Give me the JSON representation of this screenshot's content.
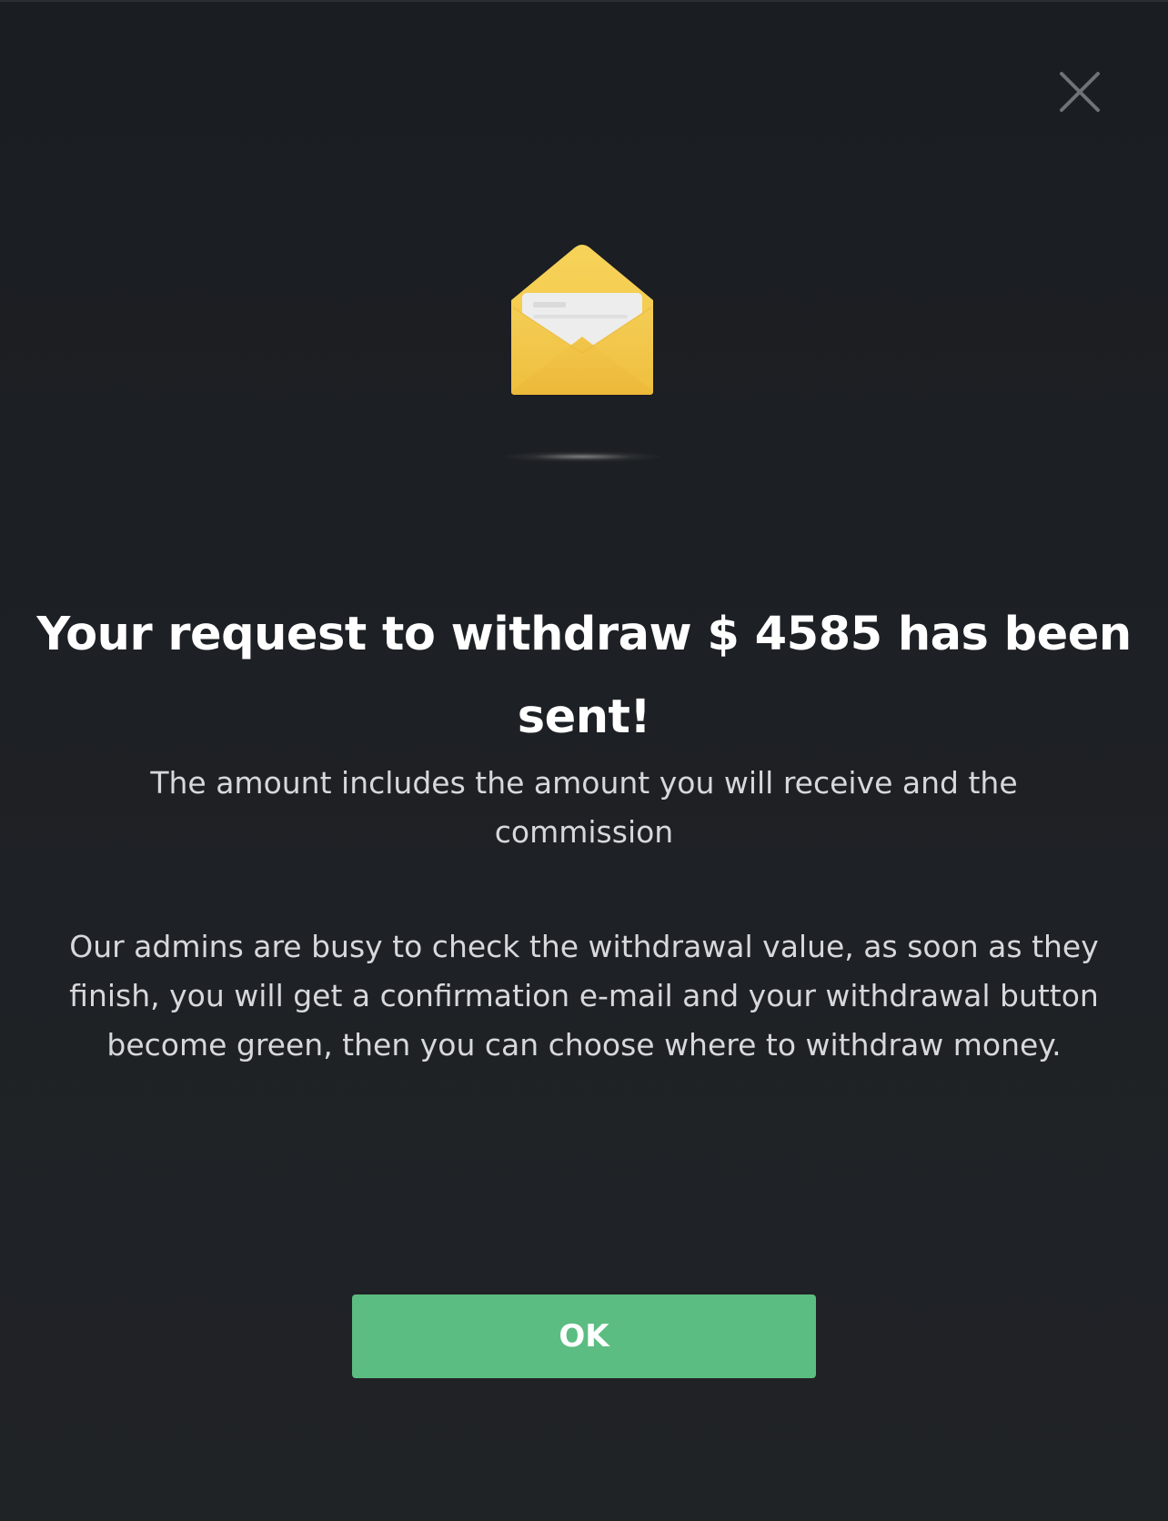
{
  "dialog": {
    "close_icon": "close-icon",
    "illustration_icon": "open-envelope-icon",
    "title": "Your request to withdraw $ 4585 has been sent!",
    "subtitle": "The amount includes the amount you will receive and the commission",
    "message": "Our admins are busy to check the withdrawal value, as soon as they finish, you will get a confirmation e-mail and your withdrawal button become green, then you can choose where to withdraw money.",
    "ok_label": "OK"
  },
  "colors": {
    "background": "#1d2024",
    "accent_button": "#5bbd81",
    "envelope": "#f2c94c",
    "text_primary": "#ffffff",
    "text_secondary": "#d6d8db",
    "close_icon": "#6f7378"
  }
}
